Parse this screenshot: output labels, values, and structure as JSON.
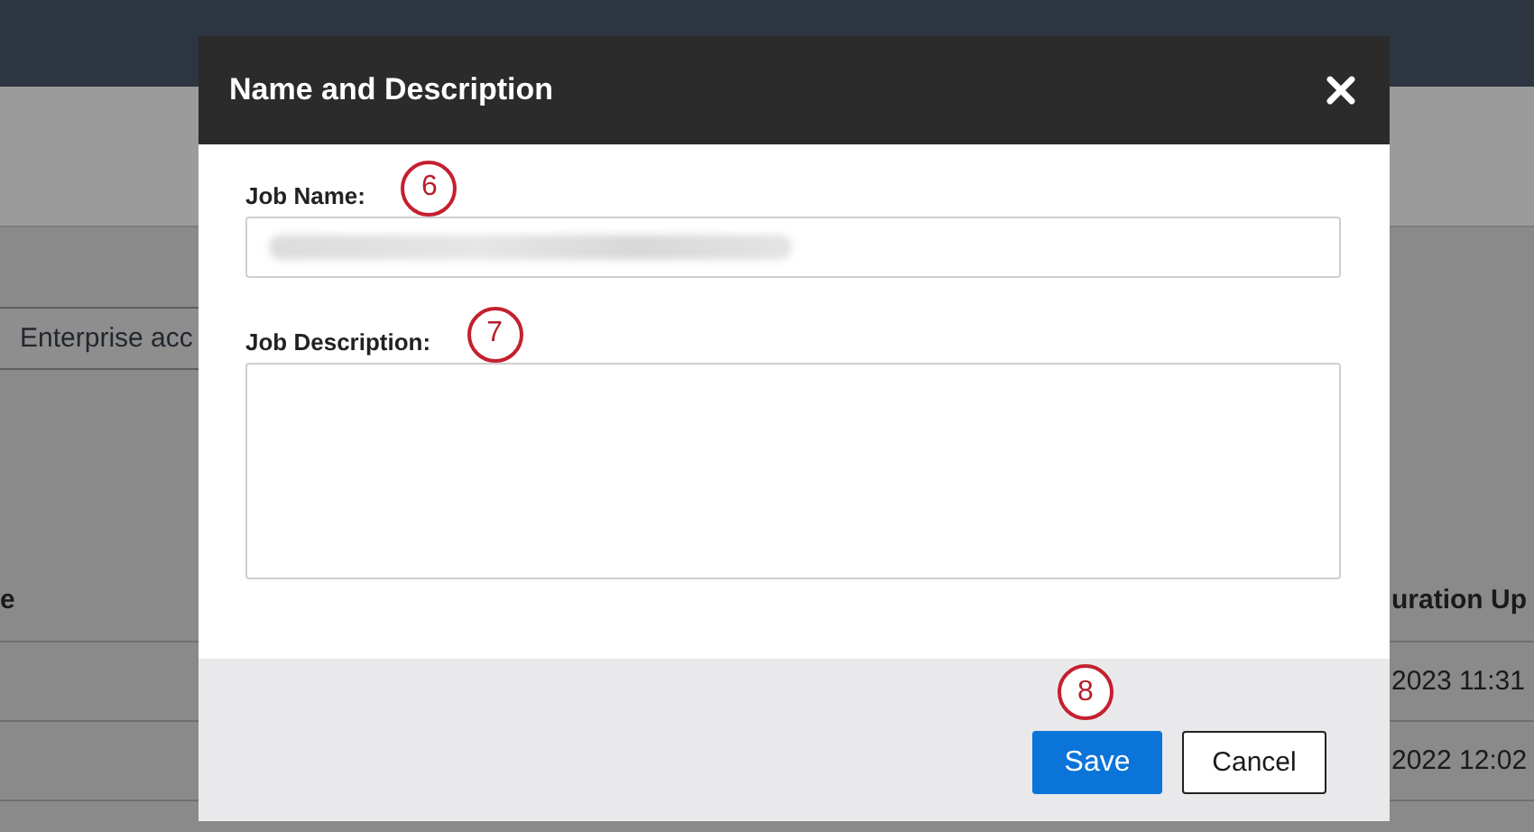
{
  "background": {
    "button": "Enterprise acc",
    "table": {
      "columns": [
        {
          "label": "e"
        },
        {
          "label": "uration Up"
        }
      ],
      "rows": [
        {
          "column_2": "2023 11:31"
        },
        {
          "column_2": "2022 12:02"
        }
      ]
    }
  },
  "dialog": {
    "title": "Name and Description",
    "fields": [
      {
        "kind": "text",
        "label": "Job Name:",
        "callout": "6"
      },
      {
        "kind": "textarea",
        "label": "Job Description:",
        "callout": "7"
      }
    ],
    "buttons": [
      {
        "kind": "primary",
        "label": "Save",
        "callout": "8"
      },
      {
        "kind": "secondary",
        "label": "Cancel"
      }
    ]
  }
}
